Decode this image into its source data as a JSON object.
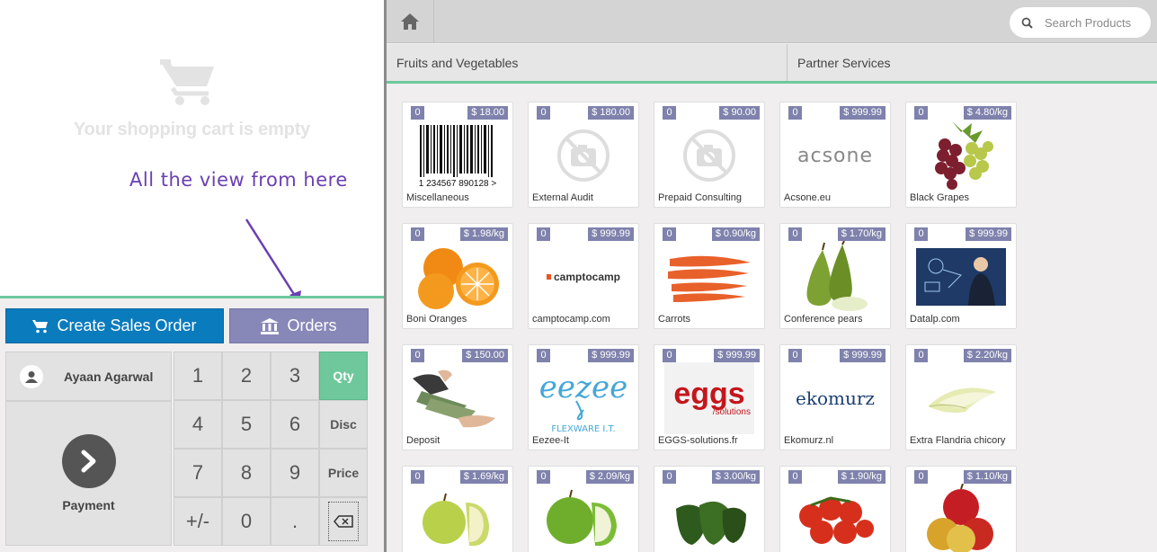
{
  "cart": {
    "empty_message": "Your shopping cart is empty"
  },
  "annotation": {
    "text": "All the view from here"
  },
  "actions": {
    "create_sales_order": "Create Sales Order",
    "orders": "Orders"
  },
  "customer": {
    "name": "Ayaan Agarwal"
  },
  "payment": {
    "label": "Payment"
  },
  "numpad": {
    "k1": "1",
    "k2": "2",
    "k3": "3",
    "k4": "4",
    "k5": "5",
    "k6": "6",
    "k7": "7",
    "k8": "8",
    "k9": "9",
    "plusminus": "+/-",
    "k0": "0",
    "dot": ".",
    "qty": "Qty",
    "disc": "Disc",
    "price": "Price"
  },
  "search": {
    "placeholder": "Search Products"
  },
  "categories": [
    "Fruits and Vegetables",
    "Partner Services"
  ],
  "products": [
    {
      "qty": "0",
      "price": "$ 18.00",
      "name": "Miscellaneous",
      "image": "barcode"
    },
    {
      "qty": "0",
      "price": "$ 180.00",
      "name": "External Audit",
      "image": "no-photo"
    },
    {
      "qty": "0",
      "price": "$ 90.00",
      "name": "Prepaid Consulting",
      "image": "no-photo"
    },
    {
      "qty": "0",
      "price": "$ 999.99",
      "name": "Acsone.eu",
      "image": "acsone-logo"
    },
    {
      "qty": "0",
      "price": "$ 4.80/kg",
      "name": "Black Grapes",
      "image": "grapes"
    },
    {
      "qty": "0",
      "price": "$ 1.98/kg",
      "name": "Boni Oranges",
      "image": "oranges"
    },
    {
      "qty": "0",
      "price": "$ 999.99",
      "name": "camptocamp.com",
      "image": "camptocamp-logo"
    },
    {
      "qty": "0",
      "price": "$ 0.90/kg",
      "name": "Carrots",
      "image": "carrots"
    },
    {
      "qty": "0",
      "price": "$ 1.70/kg",
      "name": "Conference pears",
      "image": "pears"
    },
    {
      "qty": "0",
      "price": "$ 999.99",
      "name": "Datalp.com",
      "image": "datalp"
    },
    {
      "qty": "0",
      "price": "$ 150.00",
      "name": "Deposit",
      "image": "money"
    },
    {
      "qty": "0",
      "price": "$ 999.99",
      "name": "Eezee-It",
      "image": "eezee-logo"
    },
    {
      "qty": "0",
      "price": "$ 999.99",
      "name": "EGGS-solutions.fr",
      "image": "eggs-logo"
    },
    {
      "qty": "0",
      "price": "$ 999.99",
      "name": "Ekomurz.nl",
      "image": "ekomurz-logo"
    },
    {
      "qty": "0",
      "price": "$ 2.20/kg",
      "name": "Extra Flandria chicory",
      "image": "chicory"
    },
    {
      "qty": "0",
      "price": "$ 1.69/kg",
      "name": "",
      "image": "golden-apples"
    },
    {
      "qty": "0",
      "price": "$ 2.09/kg",
      "name": "",
      "image": "green-apples"
    },
    {
      "qty": "0",
      "price": "$ 3.00/kg",
      "name": "",
      "image": "green-peppers"
    },
    {
      "qty": "0",
      "price": "$ 1.90/kg",
      "name": "",
      "image": "tomatoes"
    },
    {
      "qty": "0",
      "price": "$ 1.10/kg",
      "name": "",
      "image": "red-apples"
    }
  ],
  "logos": {
    "acsone": "acsone",
    "camptocamp": "camptocamp",
    "eezee": "eezee",
    "eezee_sub": "FLEXWARE I.T.",
    "eggs": "eggs",
    "eggs_sub": "/solutions",
    "ekomurz": "ekomurz",
    "barcode_digits": "1 234567 890128 >"
  },
  "colors": {
    "accent": "#6ec89b",
    "primary": "#0a7bbd",
    "orders": "#8787b8",
    "badge": "#7f82ac"
  }
}
